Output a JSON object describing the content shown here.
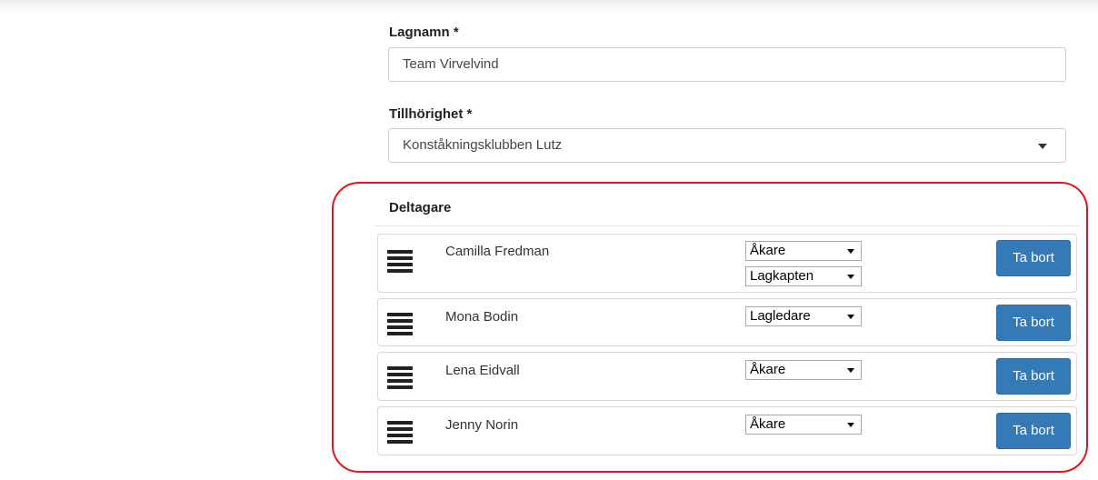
{
  "form": {
    "team_name": {
      "label": "Lagnamn *",
      "value": "Team Virvelvind"
    },
    "affiliation": {
      "label": "Tillhörighet *",
      "value": "Konståkningsklubben Lutz"
    }
  },
  "participants": {
    "title": "Deltagare",
    "remove_label": "Ta bort",
    "rows": [
      {
        "name": "Camilla Fredman",
        "roles": [
          "Åkare",
          "Lagkapten"
        ]
      },
      {
        "name": "Mona Bodin",
        "roles": [
          "Lagledare"
        ]
      },
      {
        "name": "Lena Eidvall",
        "roles": [
          "Åkare"
        ]
      },
      {
        "name": "Jenny Norin",
        "roles": [
          "Åkare"
        ]
      }
    ]
  },
  "colors": {
    "primary_button": "#337ab7",
    "highlight": "#e3141b"
  },
  "icons": {
    "drag_handle": "drag-handle-icon",
    "dropdown": "chevron-down-icon"
  }
}
